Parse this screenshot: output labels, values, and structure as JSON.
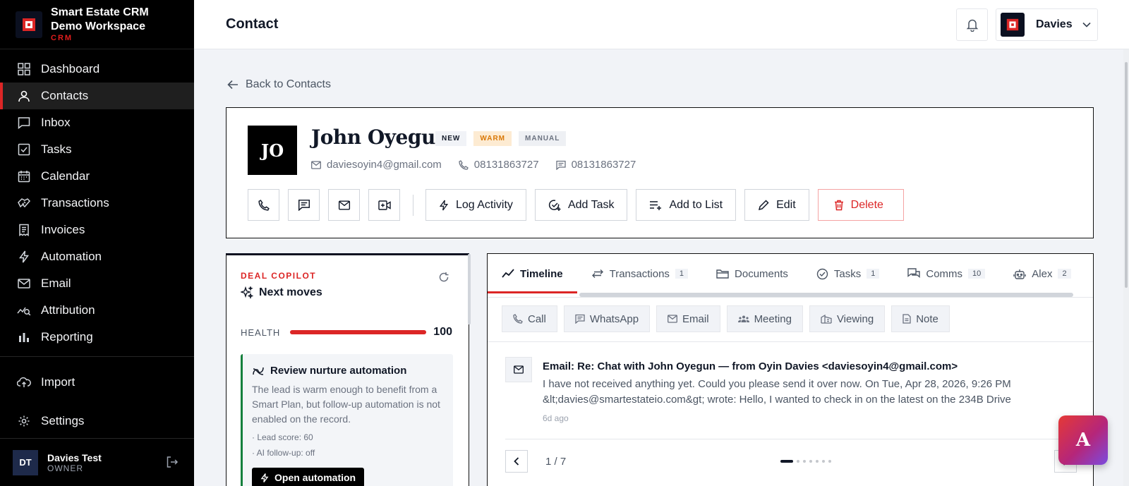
{
  "brand": {
    "line1": "Smart Estate CRM",
    "line2": "Demo Workspace",
    "tag": "CRM"
  },
  "nav": [
    {
      "label": "Dashboard",
      "icon": "grid-icon",
      "active": false
    },
    {
      "label": "Contacts",
      "icon": "user-icon",
      "active": true
    },
    {
      "label": "Inbox",
      "icon": "chat-icon",
      "active": false
    },
    {
      "label": "Tasks",
      "icon": "checkbox-icon",
      "active": false
    },
    {
      "label": "Calendar",
      "icon": "calendar-icon",
      "active": false
    },
    {
      "label": "Transactions",
      "icon": "handshake-icon",
      "active": false
    },
    {
      "label": "Invoices",
      "icon": "receipt-icon",
      "active": false
    },
    {
      "label": "Automation",
      "icon": "bolt-icon",
      "active": false
    },
    {
      "label": "Email",
      "icon": "mail-icon",
      "active": false
    },
    {
      "label": "Attribution",
      "icon": "chart-search-icon",
      "active": false
    },
    {
      "label": "Reporting",
      "icon": "bar-chart-icon",
      "active": false
    }
  ],
  "nav_lower": [
    {
      "label": "Import",
      "icon": "cloud-upload-icon"
    },
    {
      "label": "Settings",
      "icon": "gear-icon"
    }
  ],
  "user": {
    "initials": "DT",
    "name": "Davies Test",
    "role": "OWNER"
  },
  "header": {
    "title": "Contact",
    "user_name": "Davies"
  },
  "back_label": "Back to Contacts",
  "contact": {
    "initials": "JO",
    "name": "John Oyegun",
    "badges": {
      "new": "NEW",
      "warm": "WARM",
      "manual": "MANUAL"
    },
    "email": "daviesoyin4@gmail.com",
    "phone": "08131863727",
    "sms": "08131863727"
  },
  "actions": {
    "log_activity": "Log Activity",
    "add_task": "Add Task",
    "add_to_list": "Add to List",
    "edit": "Edit",
    "delete": "Delete"
  },
  "copilot": {
    "label": "DEAL COPILOT",
    "title": "Next moves",
    "health_label": "HEALTH",
    "health_value": "100",
    "health_fraction": 1.0,
    "rec_title": "Review nurture automation",
    "rec_desc": "The lead is warm enough to benefit from a Smart Plan, but follow-up automation is not enabled on the record.",
    "fact1": "· Lead score: 60",
    "fact2": "· AI follow-up: off",
    "rec_button": "Open automation"
  },
  "tabs": [
    {
      "label": "Timeline",
      "icon": "trend-icon",
      "count": "",
      "active": true
    },
    {
      "label": "Transactions",
      "icon": "swap-icon",
      "count": "1",
      "active": false
    },
    {
      "label": "Documents",
      "icon": "folder-icon",
      "count": "",
      "active": false
    },
    {
      "label": "Tasks",
      "icon": "check-circle-icon",
      "count": "1",
      "active": false
    },
    {
      "label": "Comms",
      "icon": "comments-icon",
      "count": "10",
      "active": false
    },
    {
      "label": "Alex",
      "icon": "robot-icon",
      "count": "2",
      "active": false
    }
  ],
  "quick_actions": {
    "call": "Call",
    "whatsapp": "WhatsApp",
    "email": "Email",
    "meeting": "Meeting",
    "viewing": "Viewing",
    "note": "Note"
  },
  "timeline_item": {
    "title": "Email: Re: Chat with John Oyegun — from Oyin Davies <daviesoyin4@gmail.com>",
    "body": "I have not received anything yet. Could you please send it over now. On Tue, Apr 28, 2026, 9:26 PM &lt;davies@smartestateio.com&gt; wrote: Hello, I wanted to check in on the latest on the 234B Drive",
    "time": "6d ago"
  },
  "pager": {
    "text": "1 / 7",
    "current": 1,
    "total": 7
  },
  "assistant_fab": "A",
  "colors": {
    "accent": "#dc2626",
    "sidebar": "#000000",
    "warm": "#d97706",
    "success": "#15803d"
  }
}
